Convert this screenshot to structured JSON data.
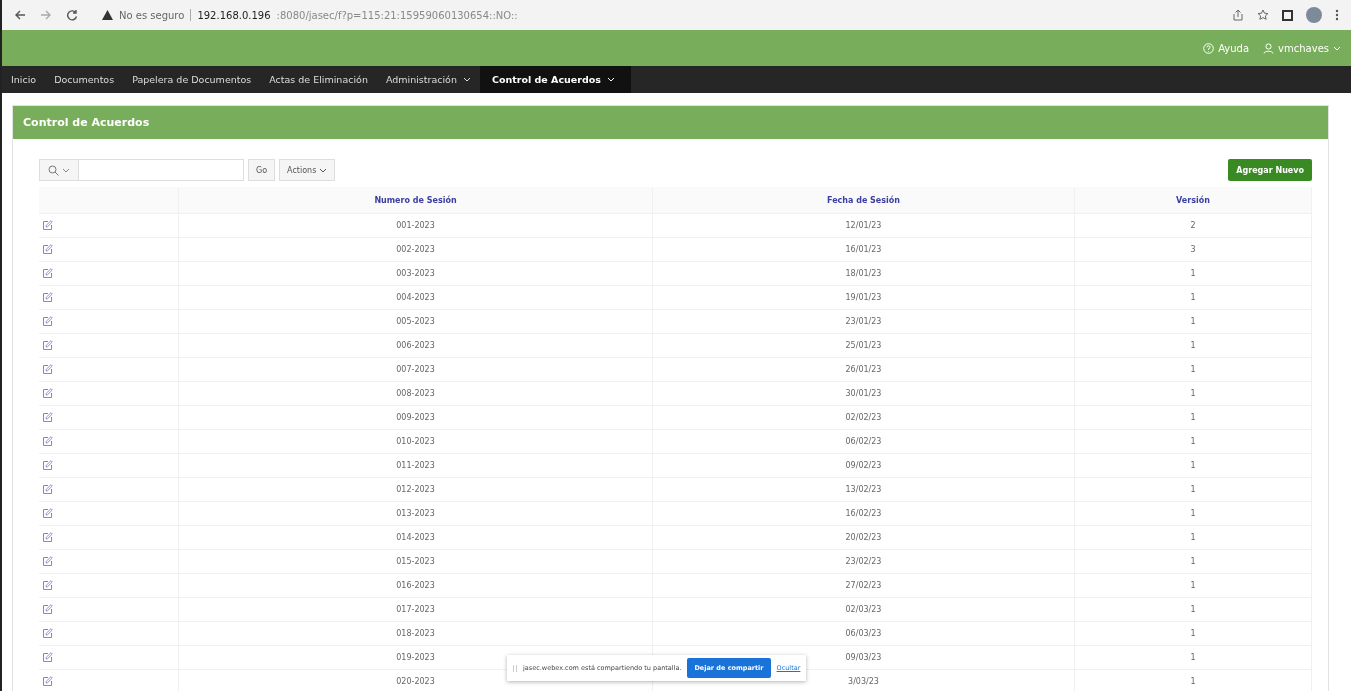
{
  "browser": {
    "security": "No es seguro",
    "url_host": "192.168.0.196",
    "url_path": ":8080/jasec/f?p=115:21:15959060130654::NO::"
  },
  "header": {
    "help": "Ayuda",
    "user": "vmchaves"
  },
  "nav": [
    {
      "label": "Inicio",
      "selected": false,
      "has_menu": false
    },
    {
      "label": "Documentos",
      "selected": false,
      "has_menu": false
    },
    {
      "label": "Papelera de Documentos",
      "selected": false,
      "has_menu": false
    },
    {
      "label": "Actas de Eliminación",
      "selected": false,
      "has_menu": false
    },
    {
      "label": "Administración",
      "selected": false,
      "has_menu": true
    },
    {
      "label": "Control de Acuerdos",
      "selected": true,
      "has_menu": true
    }
  ],
  "region": {
    "title": "Control de Acuerdos",
    "go": "Go",
    "actions": "Actions",
    "add": "Agregar Nuevo"
  },
  "table": {
    "columns": [
      "Numero de Sesión",
      "Fecha de Sesión",
      "Versión"
    ],
    "rows": [
      [
        "001-2023",
        "12/01/23",
        "2"
      ],
      [
        "002-2023",
        "16/01/23",
        "3"
      ],
      [
        "003-2023",
        "18/01/23",
        "1"
      ],
      [
        "004-2023",
        "19/01/23",
        "1"
      ],
      [
        "005-2023",
        "23/01/23",
        "1"
      ],
      [
        "006-2023",
        "25/01/23",
        "1"
      ],
      [
        "007-2023",
        "26/01/23",
        "1"
      ],
      [
        "008-2023",
        "30/01/23",
        "1"
      ],
      [
        "009-2023",
        "02/02/23",
        "1"
      ],
      [
        "010-2023",
        "06/02/23",
        "1"
      ],
      [
        "011-2023",
        "09/02/23",
        "1"
      ],
      [
        "012-2023",
        "13/02/23",
        "1"
      ],
      [
        "013-2023",
        "16/02/23",
        "1"
      ],
      [
        "014-2023",
        "20/02/23",
        "1"
      ],
      [
        "015-2023",
        "23/02/23",
        "1"
      ],
      [
        "016-2023",
        "27/02/23",
        "1"
      ],
      [
        "017-2023",
        "02/03/23",
        "1"
      ],
      [
        "018-2023",
        "06/03/23",
        "1"
      ],
      [
        "019-2023",
        "09/03/23",
        "1"
      ],
      [
        "020-2023",
        "3/03/23",
        "1"
      ]
    ]
  },
  "share_bar": {
    "message": "jasec.webex.com está compartiendo tu pantalla.",
    "stop": "Dejar de compartir",
    "hide": "Ocultar"
  }
}
